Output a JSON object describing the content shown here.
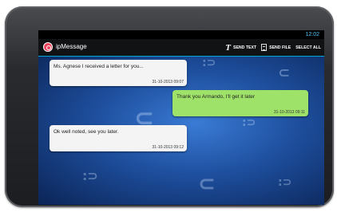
{
  "status_bar": {
    "time": "12:02"
  },
  "app_bar": {
    "title": "ipMessage",
    "send_text_label": "SEND TEXT",
    "send_file_label": "SEND FILE",
    "select_all_label": "SELECT ALL"
  },
  "messages": [
    {
      "direction": "incoming",
      "text": "Ms. Agnese I received a letter for you...",
      "timestamp": "31-10-2013 09:07"
    },
    {
      "direction": "outgoing",
      "text": "Thank you Armando, I'll get it later",
      "timestamp": "31-10-2013 09:11"
    },
    {
      "direction": "incoming",
      "text": "Ok well noted, see you later.",
      "timestamp": "31-10-2013 09:12"
    }
  ],
  "hardware_buttons": [
    "search-icon",
    "back-icon",
    "menu-icon",
    "home-icon"
  ],
  "colors": {
    "accent": "#00a9d6",
    "incoming_bubble": "#f4f4f4",
    "outgoing_bubble": "#9fe26a",
    "logo": "#e8435a"
  }
}
